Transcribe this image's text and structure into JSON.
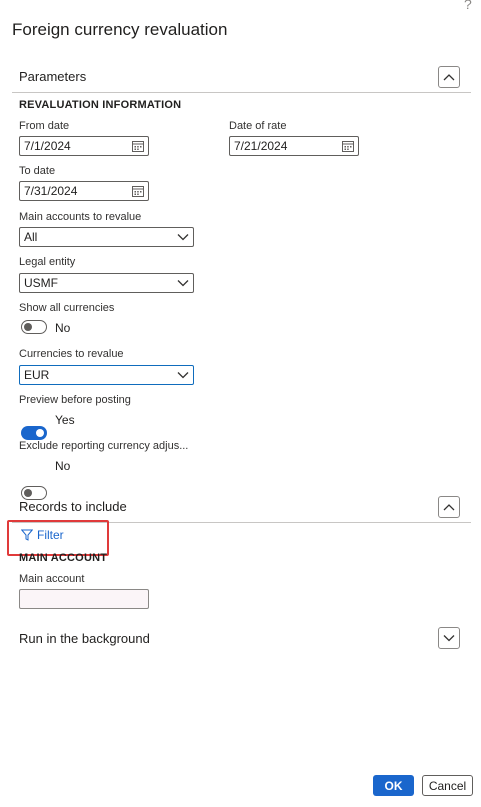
{
  "dialog": {
    "help_glyph": "?",
    "title": "Foreign currency revaluation"
  },
  "parameters": {
    "header": "Parameters",
    "group_title": "REVALUATION INFORMATION",
    "from_date": {
      "label": "From date",
      "value": "7/1/2024"
    },
    "date_of_rate": {
      "label": "Date of rate",
      "value": "7/21/2024"
    },
    "to_date": {
      "label": "To date",
      "value": "7/31/2024"
    },
    "main_accounts": {
      "label": "Main accounts to revalue",
      "value": "All"
    },
    "legal_entity": {
      "label": "Legal entity",
      "value": "USMF"
    },
    "show_all_currencies": {
      "label": "Show all currencies",
      "state": "No"
    },
    "currencies_to_revalue": {
      "label": "Currencies to revalue",
      "value": "EUR"
    },
    "preview_before_posting": {
      "label": "Preview before posting",
      "state": "Yes"
    },
    "exclude_reporting": {
      "label": "Exclude reporting currency adjus...",
      "state": "No"
    }
  },
  "records": {
    "header": "Records to include",
    "filter_label": "Filter",
    "group_title": "MAIN ACCOUNT",
    "main_account": {
      "label": "Main account",
      "value": ""
    }
  },
  "background": {
    "header": "Run in the background"
  },
  "footer": {
    "ok_label": "OK",
    "cancel_label": "Cancel"
  },
  "colors": {
    "accent": "#1a66cc",
    "highlight": "#e03a3a"
  },
  "icons": {
    "calendar": "calendar-icon",
    "dropdown": "chevron-down-icon",
    "collapse": "chevron-up-icon",
    "expand": "chevron-down-icon",
    "filter": "filter-icon"
  }
}
